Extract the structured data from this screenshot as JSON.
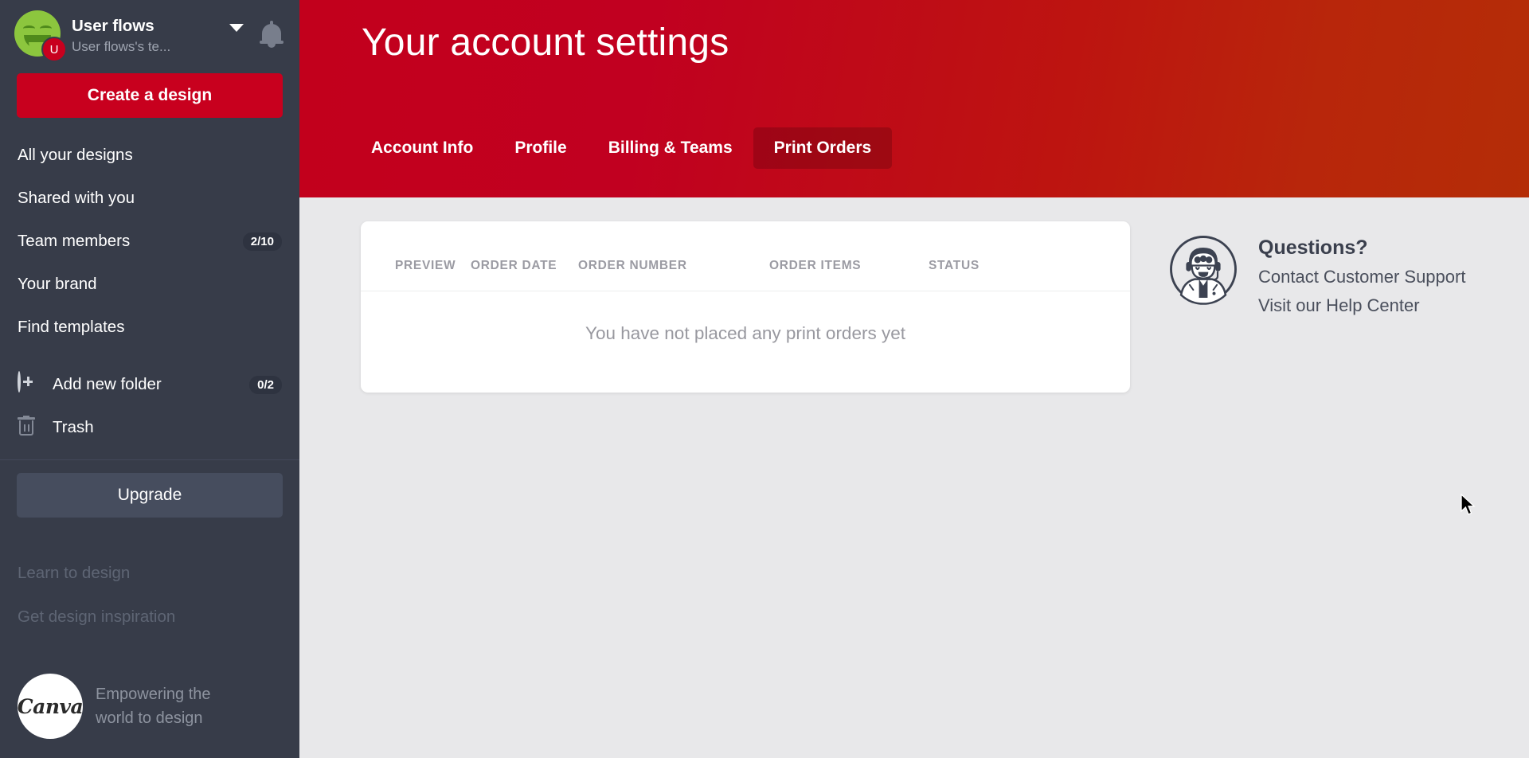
{
  "sidebar": {
    "account": {
      "name": "User flows",
      "team": "User flows's te...",
      "avatar_badge": "U",
      "dropdown_icon": "chevron-down-icon",
      "bell_icon": "bell-icon"
    },
    "create_button": "Create a design",
    "nav_items": [
      {
        "label": "All your designs",
        "count": "",
        "icon": ""
      },
      {
        "label": "Shared with you",
        "count": "",
        "icon": ""
      },
      {
        "label": "Team members",
        "count": "2/10",
        "icon": ""
      },
      {
        "label": "Your brand",
        "count": "",
        "icon": ""
      },
      {
        "label": "Find templates",
        "count": "",
        "icon": ""
      }
    ],
    "folder_items": [
      {
        "label": "Add new folder",
        "count": "0/2",
        "icon": "plus-circle-icon"
      },
      {
        "label": "Trash",
        "count": "",
        "icon": "trash-icon"
      }
    ],
    "upgrade_button": "Upgrade",
    "faint_links": [
      {
        "label": "Learn to design"
      },
      {
        "label": "Get design inspiration"
      }
    ],
    "footer": {
      "logo_text": "Canva",
      "tagline_line1": "Empowering the",
      "tagline_line2": "world to design"
    }
  },
  "header": {
    "title": "Your account settings",
    "tabs": [
      {
        "label": "Account Info",
        "active": false
      },
      {
        "label": "Profile",
        "active": false
      },
      {
        "label": "Billing & Teams",
        "active": false
      },
      {
        "label": "Print Orders",
        "active": true
      }
    ]
  },
  "orders_table": {
    "columns": [
      "PREVIEW",
      "ORDER DATE",
      "ORDER NUMBER",
      "ORDER ITEMS",
      "STATUS"
    ],
    "rows": [],
    "empty_message": "You have not placed any print orders yet"
  },
  "support": {
    "icon": "support-agent-icon",
    "title": "Questions?",
    "links": [
      "Contact Customer Support",
      "Visit our Help Center"
    ]
  },
  "colors": {
    "sidebar_bg": "#373c49",
    "brand_red": "#c8001e",
    "header_gradient_start": "#c2001c",
    "header_gradient_end": "#b42d07",
    "content_bg": "#e8e8ea",
    "card_bg": "#ffffff",
    "muted_text": "#9b9ba3"
  }
}
